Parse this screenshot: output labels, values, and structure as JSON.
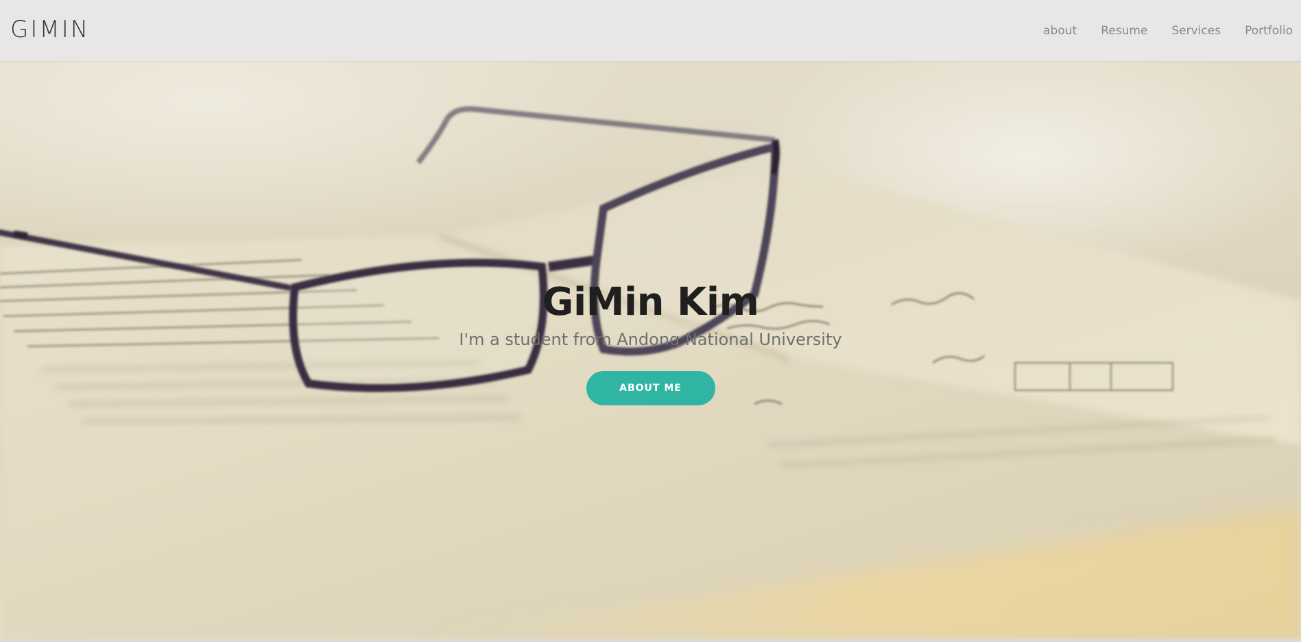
{
  "brand": {
    "name": "GIMIN"
  },
  "nav": {
    "items": [
      {
        "label": "about"
      },
      {
        "label": "Resume"
      },
      {
        "label": "Services"
      },
      {
        "label": "Portfolio"
      }
    ]
  },
  "hero": {
    "title": "GiMin Kim",
    "subtitle": "I'm a student from Andong National University",
    "button_label": "ABOUT ME",
    "accent_color": "#2fb5a2",
    "background_image": "eyeglasses-on-open-book-photo"
  }
}
